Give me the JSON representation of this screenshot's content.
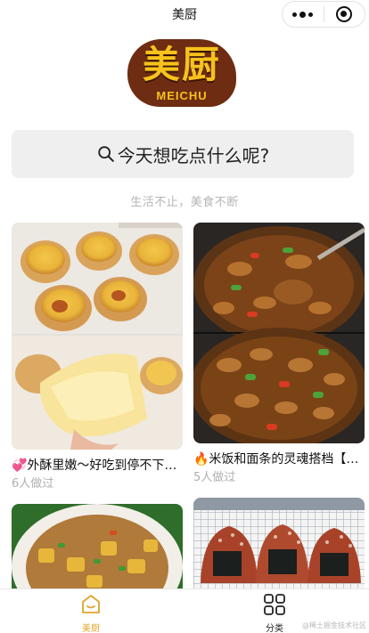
{
  "navbar": {
    "title": "美厨"
  },
  "logo": {
    "main": "美厨",
    "sub": "MEICHU"
  },
  "search": {
    "placeholder": "今天想吃点什么呢?"
  },
  "slogan": "生活不止，美食不断",
  "cards": [
    {
      "title": "💞外酥里嫩～好吃到停不下…",
      "meta": "6人做过"
    },
    {
      "title": "🔥米饭和面条的灵魂搭档【…",
      "meta": "5人做过"
    }
  ],
  "tabbar": {
    "items": [
      {
        "label": "美厨",
        "color": "#e0a42b"
      },
      {
        "label": "分类",
        "color": "#222222"
      }
    ]
  },
  "watermark": "@稀土掘金技术社区"
}
